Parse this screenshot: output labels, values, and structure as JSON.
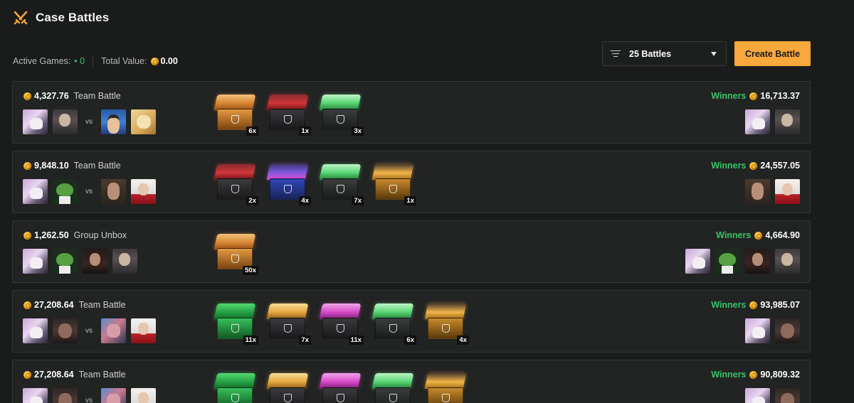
{
  "header": {
    "title": "Case Battles"
  },
  "stats": {
    "active_label": "Active Games:",
    "active_value": "• 0",
    "total_label": "Total Value:",
    "total_value": "0.00"
  },
  "filter": {
    "label": "25 Battles"
  },
  "create_label": "Create Battle",
  "vs_label": "vs",
  "winners_label": "Winners",
  "colors": {
    "accent": "#f9a83b",
    "green": "#3ac36a",
    "background": "#1a1b1b",
    "card": "#222323"
  },
  "battles": [
    {
      "amount": "4,327.76",
      "mode": "Team Battle",
      "team_a": [
        "anime",
        "man"
      ],
      "team_b": [
        "clown",
        "doge"
      ],
      "cases": [
        {
          "style": "orange",
          "count": "6x"
        },
        {
          "style": "red",
          "count": "1x"
        },
        {
          "style": "green",
          "count": "3x"
        }
      ],
      "winners_value": "16,713.37",
      "winners": [
        "anime",
        "man"
      ]
    },
    {
      "amount": "9,848.10",
      "mode": "Team Battle",
      "team_a": [
        "anime",
        "pepe"
      ],
      "team_b": [
        "bearded",
        "santa"
      ],
      "cases": [
        {
          "style": "red",
          "count": "2x"
        },
        {
          "style": "purple",
          "count": "4x"
        },
        {
          "style": "green",
          "count": "7x"
        },
        {
          "style": "gold",
          "count": "1x"
        }
      ],
      "winners_value": "24,557.05",
      "winners": [
        "bearded",
        "santa"
      ]
    },
    {
      "amount": "1,262.50",
      "mode": "Group Unbox",
      "team_a": [
        "anime",
        "pepe",
        "suit",
        "man"
      ],
      "team_b": [],
      "cases": [
        {
          "style": "orange",
          "count": "50x"
        }
      ],
      "winners_value": "4,664.90",
      "winners": [
        "anime",
        "pepe",
        "suit",
        "man"
      ]
    },
    {
      "amount": "27,208.64",
      "mode": "Team Battle",
      "team_a": [
        "anime",
        "dark"
      ],
      "team_b": [
        "mask",
        "santa"
      ],
      "cases": [
        {
          "style": "greenbox",
          "count": "11x"
        },
        {
          "style": "yellow",
          "count": "7x"
        },
        {
          "style": "pink",
          "count": "11x"
        },
        {
          "style": "green",
          "count": "6x"
        },
        {
          "style": "gold",
          "count": "4x"
        }
      ],
      "winners_value": "93,985.07",
      "winners": [
        "anime",
        "dark"
      ]
    },
    {
      "amount": "27,208.64",
      "mode": "Team Battle",
      "team_a": [
        "anime",
        "dark"
      ],
      "team_b": [
        "mask",
        "santa"
      ],
      "cases": [
        {
          "style": "greenbox",
          "count": ""
        },
        {
          "style": "yellow",
          "count": ""
        },
        {
          "style": "pink",
          "count": ""
        },
        {
          "style": "green",
          "count": ""
        },
        {
          "style": "gold",
          "count": ""
        }
      ],
      "winners_value": "90,809.32",
      "winners": [
        "anime",
        "dark"
      ]
    }
  ]
}
